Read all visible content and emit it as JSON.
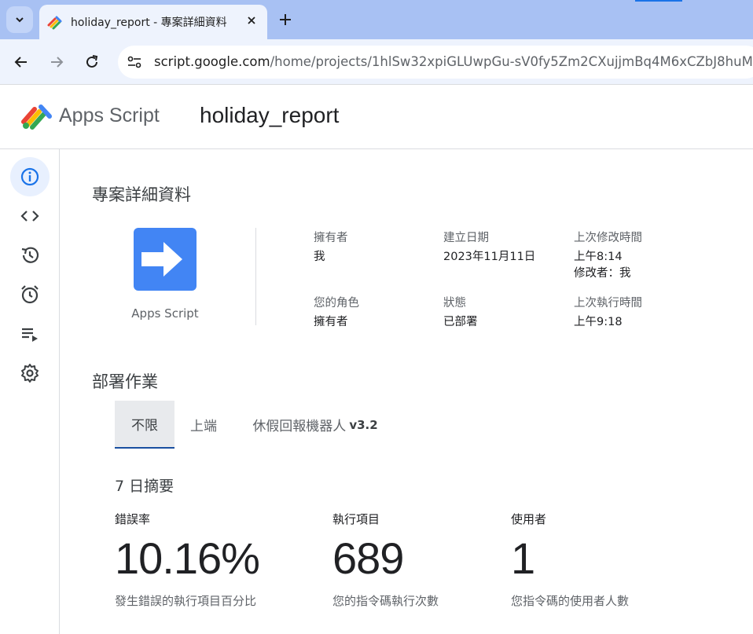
{
  "browser": {
    "tab_title": "holiday_report - 專案詳細資料",
    "url_host": "script.google.com",
    "url_path": "/home/projects/1hlSw32xpiGLUwpGu-sV0fy5Zm2CXujjmBq4M6xCZbJ8huM"
  },
  "header": {
    "product": "Apps Script",
    "project": "holiday_report"
  },
  "rail": {
    "items": [
      "overview",
      "editor",
      "executions",
      "triggers",
      "runs",
      "settings"
    ]
  },
  "details": {
    "title": "專案詳細資料",
    "icon_label": "Apps Script",
    "owner_label": "擁有者",
    "owner_value": "我",
    "created_label": "建立日期",
    "created_value": "2023年11月11日",
    "modified_label": "上次修改時間",
    "modified_time": "上午8:14",
    "modified_by": "修改者：我",
    "role_label": "您的角色",
    "role_value": "擁有者",
    "status_label": "狀態",
    "status_value": "已部署",
    "last_run_label": "上次執行時間",
    "last_run_value": "上午9:18"
  },
  "deployments": {
    "title": "部署作業",
    "tabs": [
      "不限",
      "上端",
      "休假回報機器人"
    ],
    "tab_version": "v3.2",
    "active_tab": 0
  },
  "summary": {
    "title": "7 日摘要",
    "error_rate_label": "錯誤率",
    "error_rate_value": "10.16%",
    "error_rate_desc": "發生錯誤的執行項目百分比",
    "executions_label": "執行項目",
    "executions_value": "689",
    "executions_desc": "您的指令碼執行次數",
    "users_label": "使用者",
    "users_value": "1",
    "users_desc": "您指令碼的使用者人數"
  },
  "colors": {
    "accent": "#1a73e8",
    "tabbar": "#a8c1f3",
    "icon_blue": "#4285f4"
  }
}
